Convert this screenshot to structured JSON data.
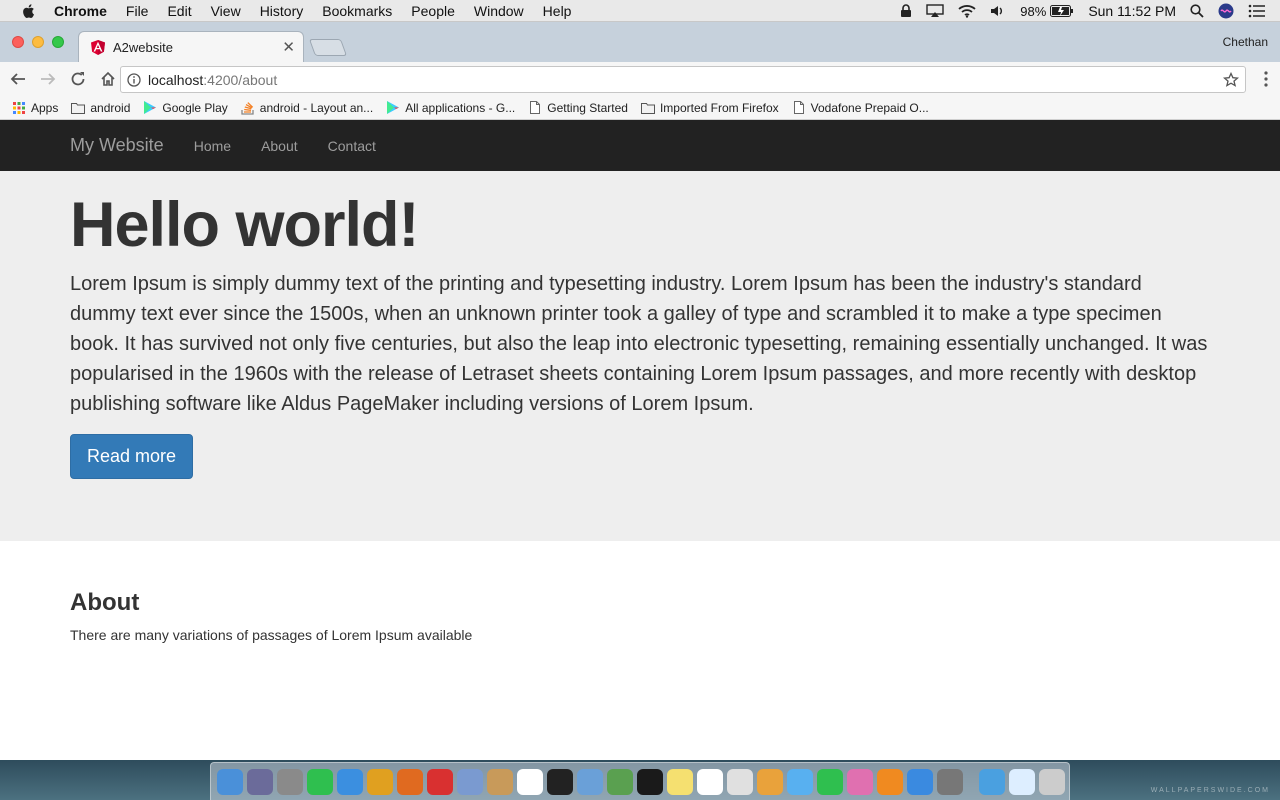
{
  "menubar": {
    "app_name": "Chrome",
    "items": [
      "File",
      "Edit",
      "View",
      "History",
      "Bookmarks",
      "People",
      "Window",
      "Help"
    ],
    "battery": "98%",
    "clock": "Sun 11:52 PM"
  },
  "browser": {
    "tab_title": "A2website",
    "profile_name": "Chethan",
    "url_host": "localhost",
    "url_path": ":4200/about",
    "bookmarks": [
      {
        "label": "Apps",
        "icon": "apps-grid-icon"
      },
      {
        "label": "android",
        "icon": "folder-icon"
      },
      {
        "label": "Google Play",
        "icon": "play-icon"
      },
      {
        "label": "android - Layout an...",
        "icon": "stack-icon"
      },
      {
        "label": "All applications - G...",
        "icon": "play-icon"
      },
      {
        "label": "Getting Started",
        "icon": "page-icon"
      },
      {
        "label": "Imported From Firefox",
        "icon": "folder-icon"
      },
      {
        "label": "Vodafone Prepaid O...",
        "icon": "page-icon"
      }
    ]
  },
  "site": {
    "brand": "My Website",
    "nav": [
      "Home",
      "About",
      "Contact"
    ],
    "hero_title": "Hello world!",
    "hero_text": "Lorem Ipsum is simply dummy text of the printing and typesetting industry. Lorem Ipsum has been the industry's standard dummy text ever since the 1500s, when an unknown printer took a galley of type and scrambled it to make a type specimen book. It has survived not only five centuries, but also the leap into electronic typesetting, remaining essentially unchanged. It was popularised in the 1960s with the release of Letraset sheets containing Lorem Ipsum passages, and more recently with desktop publishing software like Aldus PageMaker including versions of Lorem Ipsum.",
    "read_more": "Read more",
    "about_title": "About",
    "about_text": "There are many variations of passages of Lorem Ipsum available"
  },
  "dock": {
    "watermark": "WALLPAPERSWIDE.COM",
    "colors": [
      "#4a90d9",
      "#6b6b9a",
      "#8a8a8a",
      "#2fbf4f",
      "#3b8fe0",
      "#e0a020",
      "#e06a20",
      "#d93030",
      "#7a9ad0",
      "#c89a5a",
      "#ffffff",
      "#222222",
      "#6aa0d8",
      "#5aa050",
      "#1a1a1a",
      "#f5e070",
      "#ffffff",
      "#e0e0e0",
      "#e9a23b",
      "#58b0f0",
      "#2fbf4f",
      "#e070b0",
      "#f08a20",
      "#3a8ae0",
      "#777777",
      "#4aa0e0",
      "#ddeeff",
      "#cccccc"
    ]
  }
}
